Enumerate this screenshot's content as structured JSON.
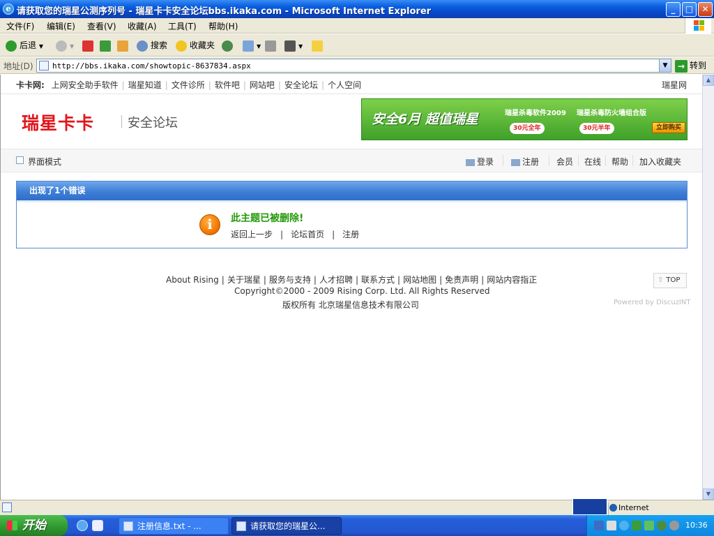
{
  "window": {
    "title": "请获取您的瑞星公测序列号 - 瑞星卡卡安全论坛bbs.ikaka.com - Microsoft Internet Explorer",
    "controls": {
      "minimize": "_",
      "maximize": "□",
      "close": "✕"
    }
  },
  "menu": [
    "文件(F)",
    "编辑(E)",
    "查看(V)",
    "收藏(A)",
    "工具(T)",
    "帮助(H)"
  ],
  "toolbar": {
    "back": "后退",
    "search": "搜索",
    "favorites": "收藏夹"
  },
  "address": {
    "label": "地址(D)",
    "url": "http://bbs.ikaka.com/showtopic-8637834.aspx",
    "go": "转到"
  },
  "site": {
    "topnav_label": "卡卡网:",
    "topnav": [
      "上网安全助手软件",
      "瑞星知道",
      "文件诊所",
      "软件吧",
      "网站吧",
      "安全论坛",
      "个人空间"
    ],
    "topnav_right": "瑞星网",
    "logo": "瑞星卡卡",
    "forum_name": "安全论坛",
    "banner": {
      "headline": "安全6月 超值瑞星",
      "product1": "瑞星杀毒软件2009",
      "product2": "瑞星杀毒防火墙组合版",
      "offer1": "30元全年",
      "offer2": "30元半年",
      "buy": "立即购买"
    },
    "mode": "界面模式",
    "userlinks": {
      "login": "登录",
      "register": "注册",
      "members": "会员",
      "online": "在线",
      "help": "帮助",
      "bookmark": "加入收藏夹"
    }
  },
  "error": {
    "header": "出现了1个错误",
    "message": "此主题已被删除!",
    "actions": [
      "返回上一步",
      "论坛首页",
      "注册"
    ]
  },
  "footer": {
    "links": [
      "About Rising",
      "关于瑞星",
      "服务与支持",
      "人才招聘",
      "联系方式",
      "网站地图",
      "免责声明",
      "网站内容指正"
    ],
    "copyright": "Copyright©2000 - 2009 Rising Corp. Ltd.  All Rights Reserved",
    "company": "版权所有 北京瑞星信息技术有限公司",
    "top": "TOP",
    "powered": "Powered by DiscuzINT"
  },
  "status": {
    "zone": "Internet"
  },
  "taskbar": {
    "start": "开始",
    "tasks": [
      "注册信息.txt - ...",
      "请获取您的瑞星公..."
    ],
    "clock": "10:36"
  }
}
